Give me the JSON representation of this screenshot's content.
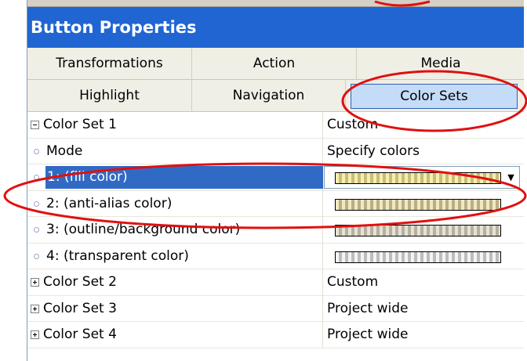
{
  "panel": {
    "title": "Button Properties"
  },
  "tabs": {
    "row1": [
      "Transformations",
      "Action",
      "Media"
    ],
    "row2": [
      "Highlight",
      "Navigation",
      "Color Sets"
    ]
  },
  "grid": {
    "color_set_1": {
      "name": "Color Set 1",
      "value": "Custom"
    },
    "props": [
      {
        "name": "Mode",
        "value": "Specify colors"
      },
      {
        "name": "1: (fill color)"
      },
      {
        "name": "2: (anti-alias color)"
      },
      {
        "name": "3: (outline/background color)"
      },
      {
        "name": "4: (transparent color)"
      }
    ],
    "color_sets": [
      {
        "name": "Color Set 2",
        "value": "Custom"
      },
      {
        "name": "Color Set 3",
        "value": "Project wide"
      },
      {
        "name": "Color Set 4",
        "value": "Project wide"
      }
    ]
  },
  "icons": {
    "collapse": "minus-box-icon",
    "expand": "plus-box-icon",
    "bullet": "circle-bullet-icon",
    "dropdown": "chevron-down-icon",
    "dropdown_glyph": "▼"
  },
  "colors": {
    "title_bar": "#2065d2",
    "selected_tab": "#c5dcf8",
    "selection": "#316ac5",
    "annotation_circle": "#e01010"
  }
}
